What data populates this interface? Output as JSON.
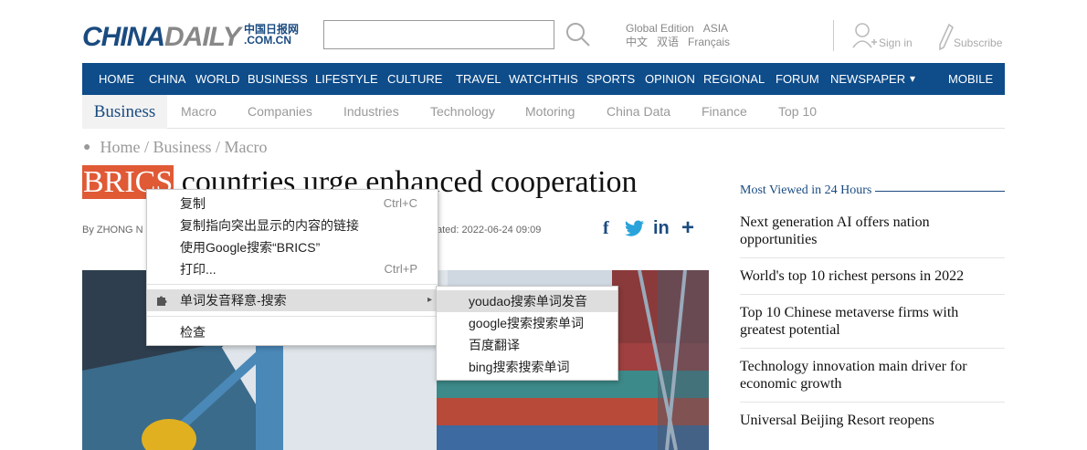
{
  "header": {
    "logo_main": "CHINA",
    "logo_second": "DAILY",
    "logo_cn": "中国日报网",
    "logo_domain": ".COM.CN",
    "search_value": "",
    "edition_label": "Global Edition",
    "edition_region": "ASIA",
    "lang_zh": "中文",
    "lang_bilingual": "双语",
    "lang_fr": "Français",
    "signin_label": "Sign in",
    "subscribe_label": "Subscribe"
  },
  "nav": {
    "items": [
      "HOME",
      "CHINA",
      "WORLD",
      "BUSINESS",
      "LIFESTYLE",
      "CULTURE",
      "TRAVEL",
      "WATCHTHIS",
      "SPORTS",
      "OPINION",
      "REGIONAL",
      "FORUM",
      "NEWSPAPER",
      "MOBILE"
    ],
    "dropdown_glyph": "▾"
  },
  "subnav": {
    "section": "Business",
    "items": [
      "Macro",
      "Companies",
      "Industries",
      "Technology",
      "Motoring",
      "China Data",
      "Finance",
      "Top 10"
    ]
  },
  "breadcrumb": "Home / Business / Macro",
  "article": {
    "headline_highlight": "BRICS",
    "headline_rest": " countries urge enhanced cooperation",
    "byline": "By ZHONG N",
    "updated": "ated: 2022-06-24 09:09"
  },
  "share": {
    "facebook": "f",
    "twitter": "t",
    "linkedin": "in",
    "more": "+"
  },
  "sidebar": {
    "title": "Most Viewed in 24 Hours",
    "items": [
      "Next generation AI offers nation opportunities",
      "World's top 10 richest persons in 2022",
      "Top 10 Chinese metaverse firms with greatest potential",
      "Technology innovation main driver for economic growth",
      "Universal Beijing Resort reopens"
    ]
  },
  "context_menu": {
    "copy": "复制",
    "copy_shortcut": "Ctrl+C",
    "copy_link": "复制指向突出显示的内容的链接",
    "google_search": "使用Google搜索“BRICS”",
    "print": "打印...",
    "print_shortcut": "Ctrl+P",
    "extension": "单词发音释意-搜索",
    "inspect": "检查",
    "arrow": "▸"
  },
  "submenu": {
    "items": [
      "youdao搜索单词发音",
      "google搜索搜索单词",
      "百度翻译",
      "bing搜索搜索单词"
    ]
  },
  "colors": {
    "nav_bg": "#0e4c8a",
    "brand_blue": "#1a4b80",
    "highlight": "#e05a36"
  }
}
